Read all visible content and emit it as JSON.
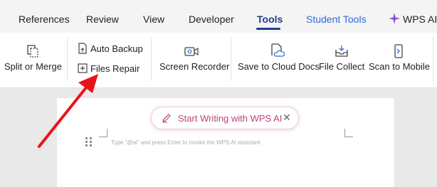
{
  "tabs": {
    "references": "References",
    "review": "Review",
    "view": "View",
    "developer": "Developer",
    "tools": "Tools",
    "student_tools": "Student Tools",
    "wps_ai": "WPS AI"
  },
  "ribbon": {
    "split_or_merge": "Split or Merge",
    "auto_backup": "Auto Backup",
    "files_repair": "Files Repair",
    "screen_recorder": "Screen Recorder",
    "save_to_cloud_docs": "Save to Cloud Docs",
    "file_collect": "File Collect",
    "scan_to_mobile": "Scan to Mobile"
  },
  "document": {
    "ai_prompt": "Start Writing with WPS AI",
    "placeholder": "Type \"@ai\" and press Enter to invoke the WPS AI assistant"
  },
  "colors": {
    "active_tab": "#1f3f8c",
    "student_tools": "#2f6bd6",
    "ai_accent": "#c2417e",
    "annotation_arrow": "#e8141b"
  },
  "icons": {
    "split_or_merge": "split-merge-icon",
    "auto_backup": "backup-icon",
    "files_repair": "repair-icon",
    "screen_recorder": "camera-icon",
    "save_to_cloud_docs": "cloud-doc-icon",
    "file_collect": "tray-icon",
    "scan_to_mobile": "phone-scan-icon",
    "wps_ai": "sparkle-icon",
    "ai_pill": "pen-icon"
  }
}
